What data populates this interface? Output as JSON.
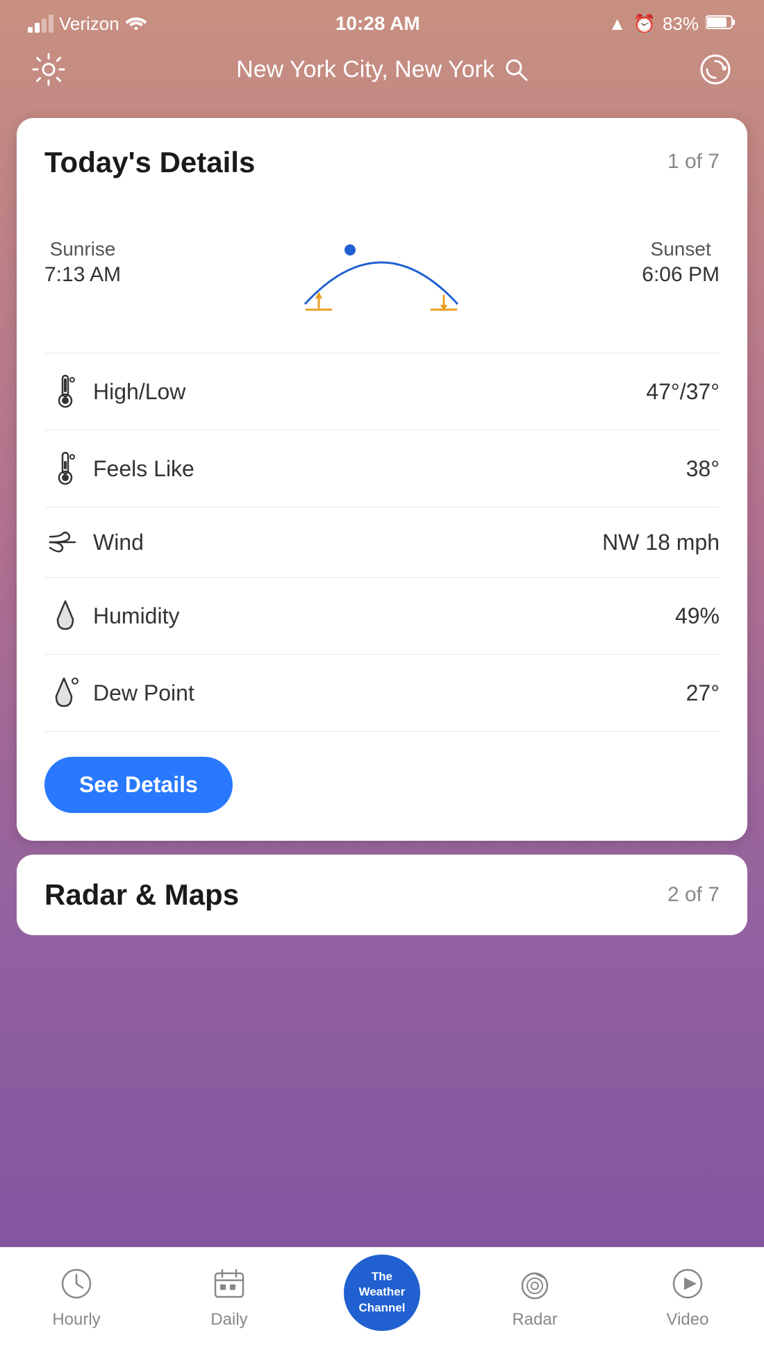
{
  "statusBar": {
    "carrier": "Verizon",
    "time": "10:28 AM",
    "battery": "83%"
  },
  "header": {
    "location": "New York City, New York",
    "gearIcon": "⚙",
    "searchIcon": "○",
    "refreshIcon": "↻"
  },
  "card": {
    "title": "Today's Details",
    "counter": "1 of 7",
    "sunrise": {
      "label": "Sunrise",
      "value": "7:13 AM"
    },
    "sunset": {
      "label": "Sunset",
      "value": "6:06 PM"
    },
    "details": [
      {
        "label": "High/Low",
        "value": "47°/37°"
      },
      {
        "label": "Feels Like",
        "value": "38°"
      },
      {
        "label": "Wind",
        "value": "NW 18 mph"
      },
      {
        "label": "Humidity",
        "value": "49%"
      },
      {
        "label": "Dew Point",
        "value": "27°"
      }
    ],
    "seeDetailsButton": "See Details"
  },
  "radarCard": {
    "title": "Radar & Maps",
    "counter": "2 of 7"
  },
  "bottomNav": {
    "items": [
      {
        "id": "hourly",
        "label": "Hourly",
        "icon": "clock"
      },
      {
        "id": "daily",
        "label": "Daily",
        "icon": "calendar"
      },
      {
        "id": "center",
        "label": "The Weather Channel",
        "icon": "twc"
      },
      {
        "id": "radar",
        "label": "Radar",
        "icon": "radar"
      },
      {
        "id": "video",
        "label": "Video",
        "icon": "play"
      }
    ]
  }
}
